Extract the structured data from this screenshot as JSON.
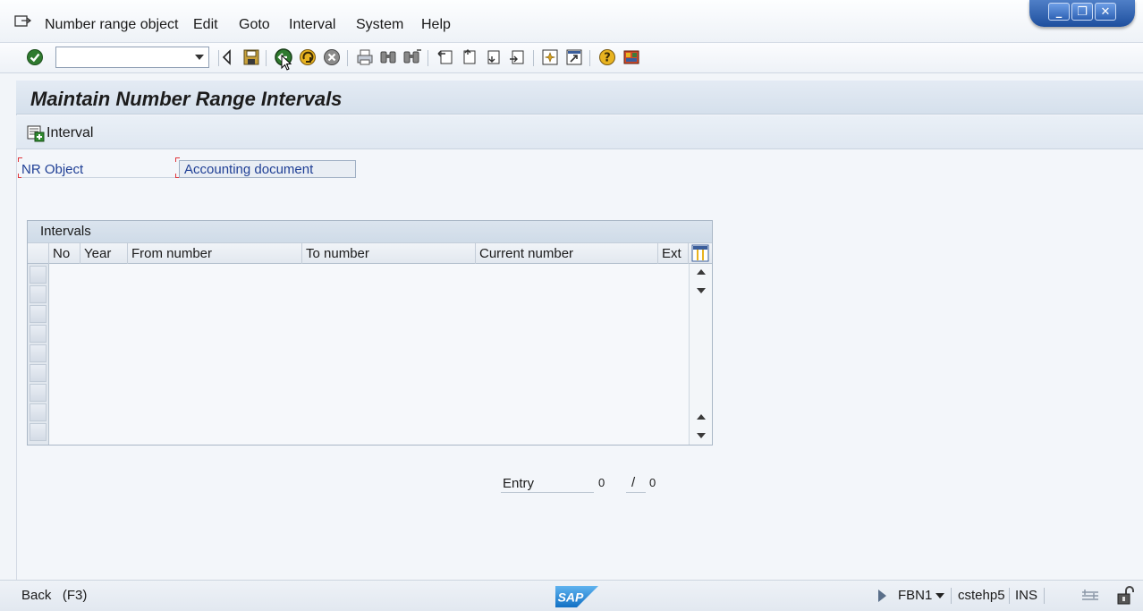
{
  "menubar": {
    "items": [
      "Number range object",
      "Edit",
      "Goto",
      "Interval",
      "System",
      "Help"
    ]
  },
  "window_controls": {
    "minimize": "_",
    "restore": "❐",
    "close": "✕"
  },
  "toolbar": {
    "command_field_value": "",
    "icons": [
      "enter-icon",
      "back-arrow-icon",
      "save-icon",
      "back-icon",
      "exit-icon",
      "cancel-icon",
      "print-icon",
      "find-icon",
      "find-next-icon",
      "first-page-icon",
      "previous-page-icon",
      "next-page-icon",
      "last-page-icon",
      "create-session-icon",
      "shortcut-icon",
      "help-icon",
      "customize-layout-icon"
    ]
  },
  "page": {
    "title": "Maintain Number Range Intervals"
  },
  "app_toolbar": {
    "interval_button_label": "Interval"
  },
  "form": {
    "nr_object_label": "NR Object",
    "nr_object_value": "Accounting document"
  },
  "table": {
    "caption": "Intervals",
    "columns": [
      "No",
      "Year",
      "From number",
      "To number",
      "Current number",
      "Ext"
    ],
    "rows": []
  },
  "entry": {
    "label": "Entry",
    "current": "0",
    "slash": "/",
    "total": "0"
  },
  "statusbar": {
    "message": "Back   (F3)",
    "transaction": "FBN1",
    "server": "cstehp5",
    "mode": "INS",
    "logo_text": "SAP"
  },
  "colors": {
    "accent_blue": "#1f3f95",
    "required_red": "#e0353a",
    "window_ctrl_blue": "#2d61b3"
  }
}
